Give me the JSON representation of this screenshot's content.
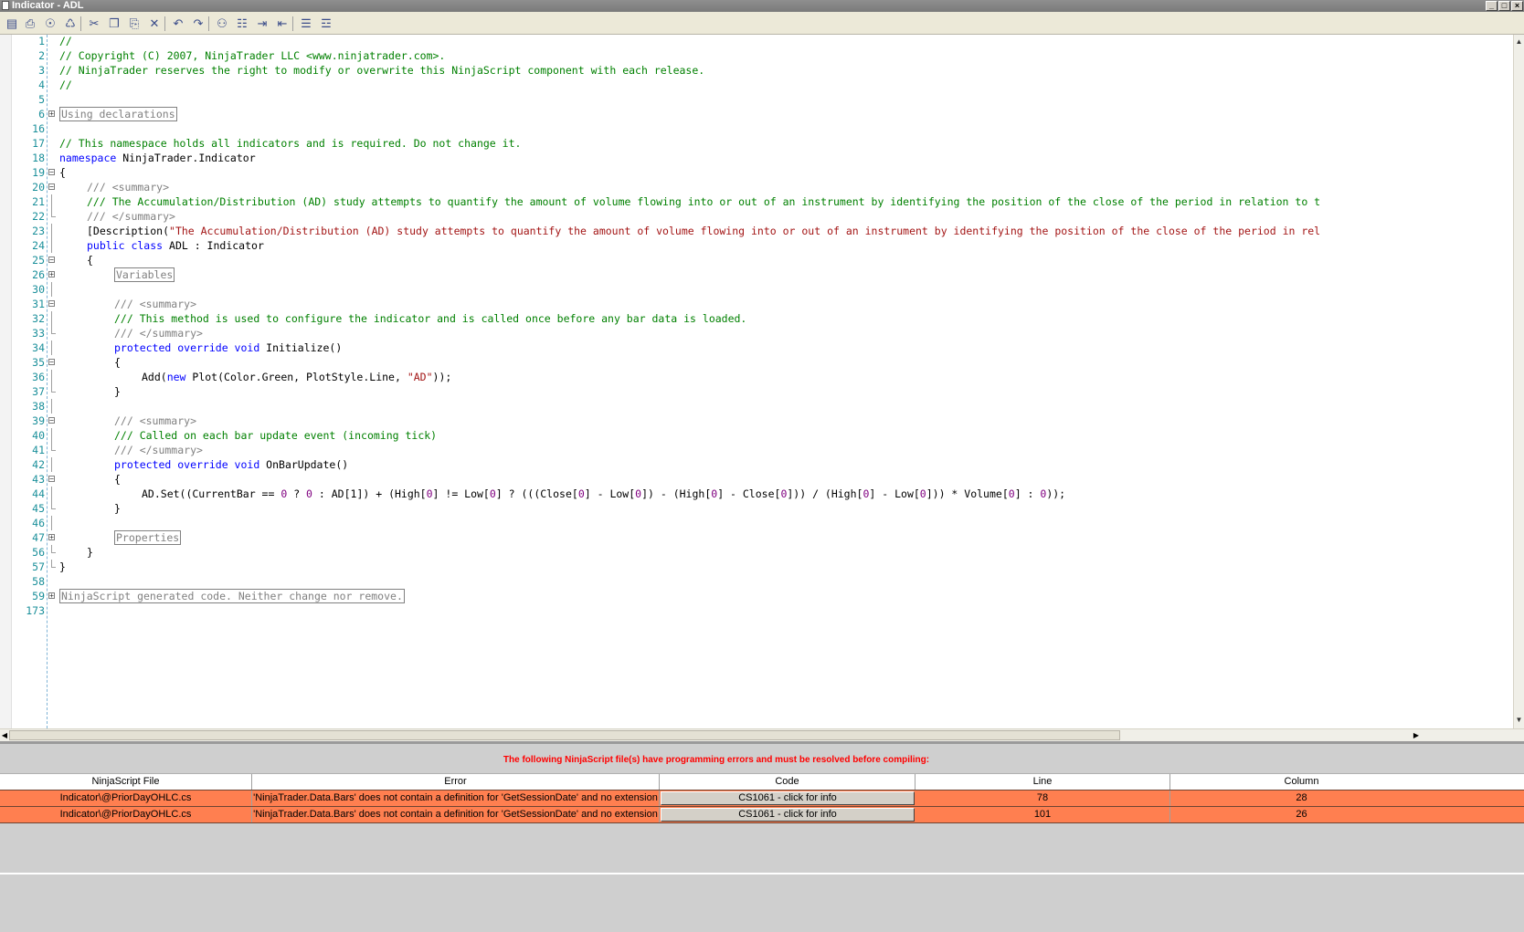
{
  "window": {
    "title": "Indicator - ADL",
    "controls": [
      "_",
      "□",
      "×"
    ]
  },
  "toolbar": {
    "buttons": [
      {
        "name": "save-icon",
        "glyph": "▤"
      },
      {
        "name": "print-icon",
        "glyph": "⎙"
      },
      {
        "name": "print-preview-icon",
        "glyph": "☉"
      },
      {
        "name": "compile-icon",
        "glyph": "♺"
      },
      {
        "name": "cut-icon",
        "glyph": "✂"
      },
      {
        "name": "copy-icon",
        "glyph": "❐"
      },
      {
        "name": "paste-icon",
        "glyph": "⎘"
      },
      {
        "name": "delete-icon",
        "glyph": "✕"
      },
      {
        "name": "undo-icon",
        "glyph": "↶"
      },
      {
        "name": "redo-icon",
        "glyph": "↷"
      },
      {
        "name": "find-icon",
        "glyph": "⚇"
      },
      {
        "name": "replace-icon",
        "glyph": "☷"
      },
      {
        "name": "indent-icon",
        "glyph": "⇥"
      },
      {
        "name": "outdent-icon",
        "glyph": "⇤"
      },
      {
        "name": "comment-icon",
        "glyph": "☰"
      },
      {
        "name": "uncomment-icon",
        "glyph": "☲"
      }
    ]
  },
  "editor": {
    "lines": [
      {
        "num": "1",
        "fold": "",
        "indent": 0,
        "tokens": [
          [
            "com",
            "//"
          ]
        ]
      },
      {
        "num": "2",
        "fold": "",
        "indent": 0,
        "tokens": [
          [
            "com",
            "// Copyright (C) 2007, NinjaTrader LLC <www.ninjatrader.com>."
          ]
        ]
      },
      {
        "num": "3",
        "fold": "",
        "indent": 0,
        "tokens": [
          [
            "com",
            "// NinjaTrader reserves the right to modify or overwrite this NinjaScript component with each release."
          ]
        ]
      },
      {
        "num": "4",
        "fold": "",
        "indent": 0,
        "tokens": [
          [
            "com",
            "//"
          ]
        ]
      },
      {
        "num": "5",
        "fold": "",
        "indent": 0,
        "tokens": []
      },
      {
        "num": "6",
        "fold": "+",
        "indent": 0,
        "tokens": [
          [
            "coll",
            "Using declarations"
          ]
        ]
      },
      {
        "num": "16",
        "fold": "",
        "indent": 0,
        "tokens": []
      },
      {
        "num": "17",
        "fold": "",
        "indent": 0,
        "tokens": [
          [
            "com",
            "// This namespace holds all indicators and is required. Do not change it."
          ]
        ]
      },
      {
        "num": "18",
        "fold": "",
        "indent": 0,
        "tokens": [
          [
            "kw",
            "namespace"
          ],
          [
            "txt",
            " NinjaTrader.Indicator"
          ]
        ]
      },
      {
        "num": "19",
        "fold": "-",
        "indent": 0,
        "tokens": [
          [
            "txt",
            "{"
          ]
        ]
      },
      {
        "num": "20",
        "fold": "-",
        "indent": 1,
        "tokens": [
          [
            "cmt",
            "/// <summary>"
          ]
        ]
      },
      {
        "num": "21",
        "fold": "|",
        "indent": 1,
        "tokens": [
          [
            "com",
            "/// The Accumulation/Distribution (AD) study attempts to quantify the amount of volume flowing into or out of an instrument by identifying the position of the close of the period in relation to t"
          ]
        ]
      },
      {
        "num": "22",
        "fold": "L",
        "indent": 1,
        "tokens": [
          [
            "cmt",
            "/// </summary>"
          ]
        ]
      },
      {
        "num": "23",
        "fold": "|",
        "indent": 1,
        "tokens": [
          [
            "txt",
            "[Description("
          ],
          [
            "str",
            "\"The Accumulation/Distribution (AD) study attempts to quantify the amount of volume flowing into or out of an instrument by identifying the position of the close of the period in rel"
          ]
        ]
      },
      {
        "num": "24",
        "fold": "|",
        "indent": 1,
        "tokens": [
          [
            "kw",
            "public class"
          ],
          [
            "txt",
            " ADL : Indicator"
          ]
        ]
      },
      {
        "num": "25",
        "fold": "-",
        "indent": 1,
        "tokens": [
          [
            "txt",
            "{"
          ]
        ]
      },
      {
        "num": "26",
        "fold": "+",
        "indent": 2,
        "tokens": [
          [
            "coll",
            "Variables"
          ]
        ]
      },
      {
        "num": "30",
        "fold": "|",
        "indent": 0,
        "tokens": []
      },
      {
        "num": "31",
        "fold": "-",
        "indent": 2,
        "tokens": [
          [
            "cmt",
            "/// <summary>"
          ]
        ]
      },
      {
        "num": "32",
        "fold": "|",
        "indent": 2,
        "tokens": [
          [
            "com",
            "/// This method is used to configure the indicator and is called once before any bar data is loaded."
          ]
        ]
      },
      {
        "num": "33",
        "fold": "L",
        "indent": 2,
        "tokens": [
          [
            "cmt",
            "/// </summary>"
          ]
        ]
      },
      {
        "num": "34",
        "fold": "|",
        "indent": 2,
        "tokens": [
          [
            "kw",
            "protected override void"
          ],
          [
            "txt",
            " Initialize()"
          ]
        ]
      },
      {
        "num": "35",
        "fold": "-",
        "indent": 2,
        "tokens": [
          [
            "txt",
            "{"
          ]
        ]
      },
      {
        "num": "36",
        "fold": "|",
        "indent": 3,
        "tokens": [
          [
            "txt",
            "Add("
          ],
          [
            "kw",
            "new"
          ],
          [
            "txt",
            " Plot(Color.Green, PlotStyle.Line, "
          ],
          [
            "str",
            "\"AD\""
          ],
          [
            "txt",
            "));"
          ]
        ]
      },
      {
        "num": "37",
        "fold": "L",
        "indent": 2,
        "tokens": [
          [
            "txt",
            "}"
          ]
        ]
      },
      {
        "num": "38",
        "fold": "|",
        "indent": 0,
        "tokens": []
      },
      {
        "num": "39",
        "fold": "-",
        "indent": 2,
        "tokens": [
          [
            "cmt",
            "/// <summary>"
          ]
        ]
      },
      {
        "num": "40",
        "fold": "|",
        "indent": 2,
        "tokens": [
          [
            "com",
            "/// Called on each bar update event (incoming tick)"
          ]
        ]
      },
      {
        "num": "41",
        "fold": "L",
        "indent": 2,
        "tokens": [
          [
            "cmt",
            "/// </summary>"
          ]
        ]
      },
      {
        "num": "42",
        "fold": "|",
        "indent": 2,
        "tokens": [
          [
            "kw",
            "protected override void"
          ],
          [
            "txt",
            " OnBarUpdate()"
          ]
        ]
      },
      {
        "num": "43",
        "fold": "-",
        "indent": 2,
        "tokens": [
          [
            "txt",
            "{"
          ]
        ]
      },
      {
        "num": "44",
        "fold": "|",
        "indent": 3,
        "tokens": [
          [
            "txt",
            "AD.Set((CurrentBar == "
          ],
          [
            "num",
            "0"
          ],
          [
            "txt",
            " ? "
          ],
          [
            "num",
            "0"
          ],
          [
            "txt",
            " : AD[1]) + (High["
          ],
          [
            "num",
            "0"
          ],
          [
            "txt",
            "] != Low["
          ],
          [
            "num",
            "0"
          ],
          [
            "txt",
            "] ? (((Close["
          ],
          [
            "num",
            "0"
          ],
          [
            "txt",
            "] - Low["
          ],
          [
            "num",
            "0"
          ],
          [
            "txt",
            "]) - (High["
          ],
          [
            "num",
            "0"
          ],
          [
            "txt",
            "] - Close["
          ],
          [
            "num",
            "0"
          ],
          [
            "txt",
            "])) / (High["
          ],
          [
            "num",
            "0"
          ],
          [
            "txt",
            "] - Low["
          ],
          [
            "num",
            "0"
          ],
          [
            "txt",
            "])) * Volume["
          ],
          [
            "num",
            "0"
          ],
          [
            "txt",
            "] : "
          ],
          [
            "num",
            "0"
          ],
          [
            "txt",
            "));"
          ]
        ]
      },
      {
        "num": "45",
        "fold": "L",
        "indent": 2,
        "tokens": [
          [
            "txt",
            "}"
          ]
        ]
      },
      {
        "num": "46",
        "fold": "|",
        "indent": 0,
        "tokens": []
      },
      {
        "num": "47",
        "fold": "+",
        "indent": 2,
        "tokens": [
          [
            "coll",
            "Properties"
          ]
        ]
      },
      {
        "num": "56",
        "fold": "L",
        "indent": 1,
        "tokens": [
          [
            "txt",
            "}"
          ]
        ]
      },
      {
        "num": "57",
        "fold": "E",
        "indent": 0,
        "tokens": [
          [
            "txt",
            "}"
          ]
        ]
      },
      {
        "num": "58",
        "fold": "",
        "indent": 0,
        "tokens": []
      },
      {
        "num": "59",
        "fold": "+",
        "indent": 0,
        "tokens": [
          [
            "coll",
            "NinjaScript generated code. Neither change nor remove."
          ]
        ]
      },
      {
        "num": "173",
        "fold": "",
        "indent": 0,
        "tokens": []
      }
    ]
  },
  "errors": {
    "message": "The following NinjaScript file(s) have programming errors and must be resolved before compiling:",
    "columns": [
      "NinjaScript File",
      "Error",
      "Code",
      "Line",
      "Column"
    ],
    "rows": [
      {
        "file": "Indicator\\@PriorDayOHLC.cs",
        "error": "'NinjaTrader.Data.Bars' does not contain a definition for 'GetSessionDate' and no extension",
        "code": "CS1061 - click for info",
        "line": "78",
        "column": "28"
      },
      {
        "file": "Indicator\\@PriorDayOHLC.cs",
        "error": "'NinjaTrader.Data.Bars' does not contain a definition for 'GetSessionDate' and no extension",
        "code": "CS1061 - click for info",
        "line": "101",
        "column": "26"
      }
    ],
    "row_color": "#ff7f50",
    "message_color": "#ff0000"
  }
}
